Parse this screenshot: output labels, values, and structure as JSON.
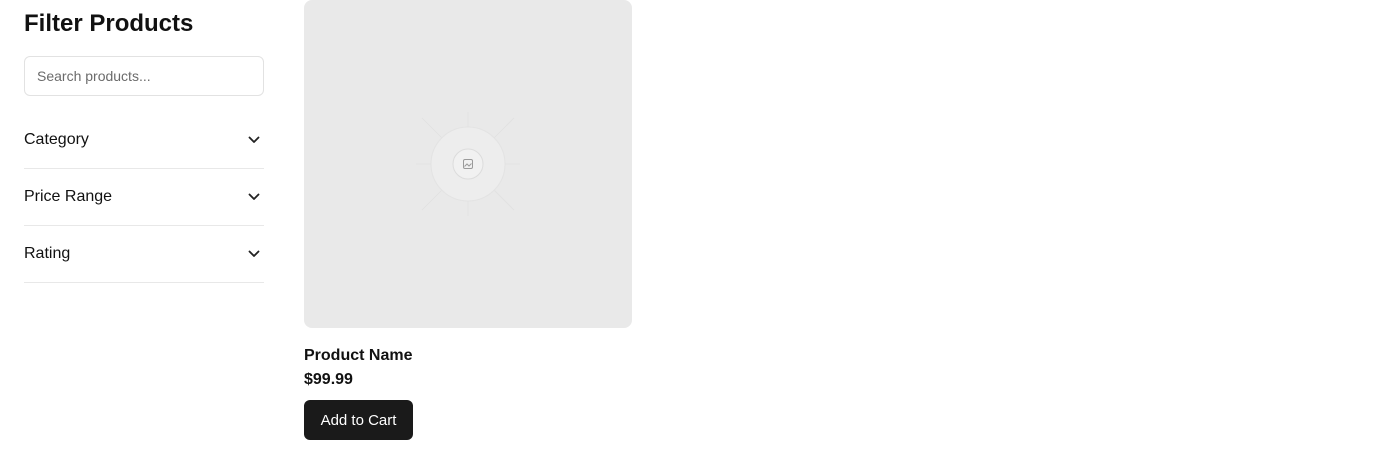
{
  "sidebar": {
    "title": "Filter Products",
    "search": {
      "placeholder": "Search products...",
      "value": ""
    },
    "filters": [
      {
        "label": "Category",
        "icon": "chevron-down-icon"
      },
      {
        "label": "Price Range",
        "icon": "chevron-down-icon"
      },
      {
        "label": "Rating",
        "icon": "chevron-down-icon"
      }
    ]
  },
  "product": {
    "image_icon": "image-placeholder-icon",
    "name": "Product Name",
    "price": "$99.99",
    "add_label": "Add to Cart"
  },
  "colors": {
    "button_bg": "#1a1a1a",
    "image_bg": "#e9e9e9",
    "divider": "#e8e8e8"
  }
}
